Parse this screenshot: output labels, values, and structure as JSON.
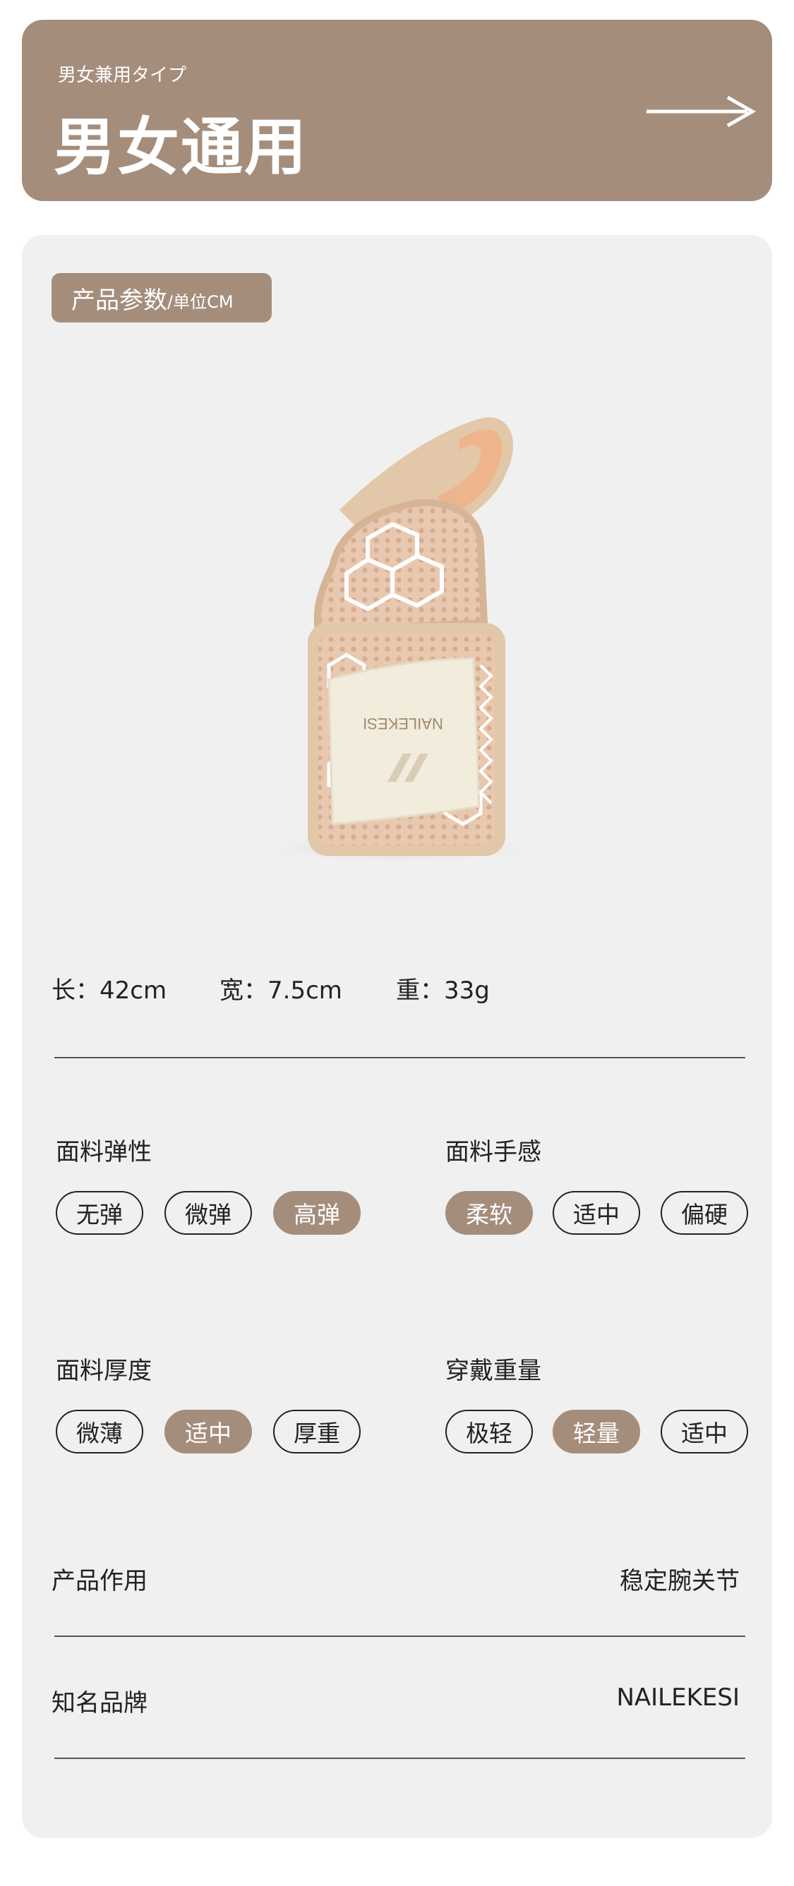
{
  "banner": {
    "subtitle": "男女兼用タイプ",
    "title": "男女通用"
  },
  "params": {
    "tag_main": "产品参数",
    "tag_unit": "/单位CM"
  },
  "product_image": {
    "brand_print": "NAILEKESI",
    "description_icon": "wrist-brace-image"
  },
  "dimensions": {
    "length": "长：42cm",
    "width": "宽：7.5cm",
    "weight": "重：33g"
  },
  "attributes": [
    {
      "label": "面料弹性",
      "options": [
        "无弹",
        "微弹",
        "高弹"
      ],
      "selected": 2
    },
    {
      "label": "面料手感",
      "options": [
        "柔软",
        "适中",
        "偏硬"
      ],
      "selected": 0
    },
    {
      "label": "面料厚度",
      "options": [
        "微薄",
        "适中",
        "厚重"
      ],
      "selected": 1
    },
    {
      "label": "穿戴重量",
      "options": [
        "极轻",
        "轻量",
        "适中"
      ],
      "selected": 1
    }
  ],
  "rows": [
    {
      "label": "产品作用",
      "value": "稳定腕关节"
    },
    {
      "label": "知名品牌",
      "value": "NAILEKESI"
    }
  ],
  "colors": {
    "accent": "#a58d7c",
    "card_bg": "#f0f0f0",
    "text": "#222222"
  }
}
